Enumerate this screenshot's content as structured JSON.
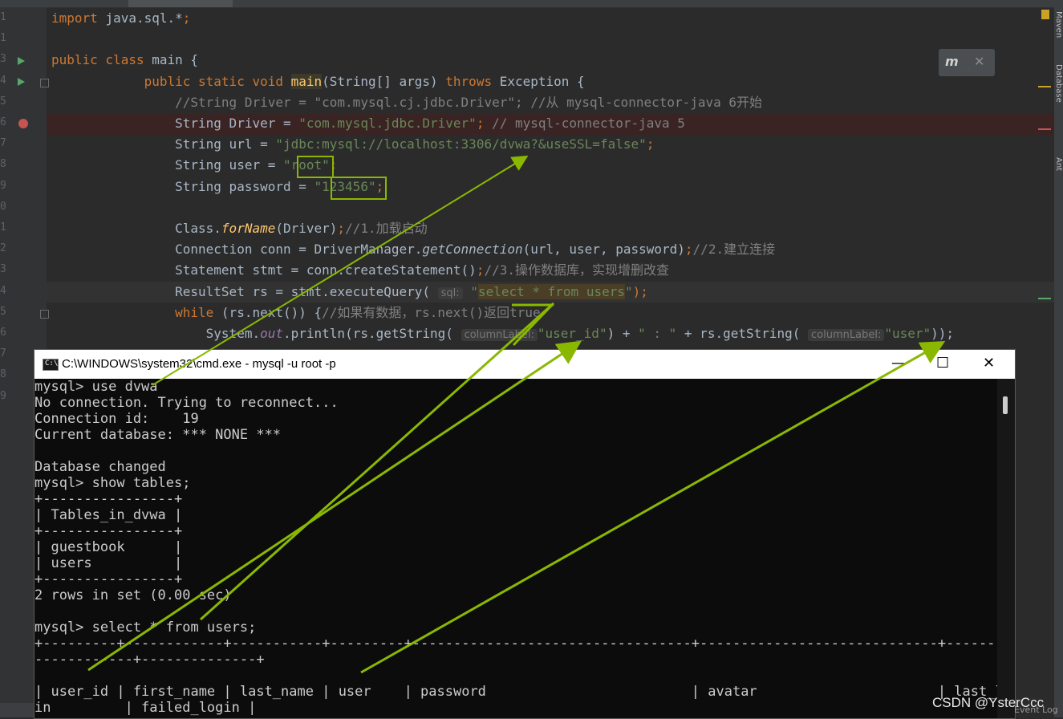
{
  "tabs": [
    "",
    "",
    "",
    ""
  ],
  "gutter": {
    "line_numbers": [
      "1",
      "1",
      "3",
      "4",
      "5",
      "6",
      "7",
      "8",
      "9",
      "0",
      "1",
      "2",
      "3",
      "4",
      "5",
      "6",
      "7",
      "8",
      "9"
    ],
    "partial_lines_below": [
      "8",
      "9"
    ]
  },
  "editor": {
    "lines": [
      {
        "segments": [
          {
            "t": "import ",
            "c": "kw"
          },
          {
            "t": "java.sql.*",
            "c": ""
          },
          {
            "t": ";",
            "c": "kw"
          }
        ]
      },
      {
        "segments": []
      },
      {
        "segments": [
          {
            "t": "public class ",
            "c": "kw"
          },
          {
            "t": "main {",
            "c": ""
          }
        ]
      },
      {
        "segments": [
          {
            "t": "            public static void ",
            "c": "kw"
          },
          {
            "t": "main",
            "c": "fn hl-main"
          },
          {
            "t": "(String[] args) ",
            "c": ""
          },
          {
            "t": "throws ",
            "c": "kw"
          },
          {
            "t": "Exception {",
            "c": ""
          }
        ]
      },
      {
        "segments": [
          {
            "t": "                //String Driver = \"com.mysql.cj.jdbc.Driver\"; //从 mysql-connector-java 6开始",
            "c": "cm"
          }
        ]
      },
      {
        "segments": [
          {
            "t": "                String Driver = ",
            "c": ""
          },
          {
            "t": "\"com.mysql.jdbc.Driver\"",
            "c": "str"
          },
          {
            "t": "; ",
            "c": "kw"
          },
          {
            "t": "// mysql-connector-java 5",
            "c": "cm"
          }
        ]
      },
      {
        "segments": [
          {
            "t": "                String url = ",
            "c": ""
          },
          {
            "t": "\"jdbc:mysql://localhost:3306/dvwa?&useSSL=false\"",
            "c": "str"
          },
          {
            "t": ";",
            "c": "kw"
          }
        ]
      },
      {
        "segments": [
          {
            "t": "                String user = ",
            "c": ""
          },
          {
            "t": "\"root\"",
            "c": "str"
          },
          {
            "t": ";",
            "c": "kw"
          }
        ]
      },
      {
        "segments": [
          {
            "t": "                String password = ",
            "c": ""
          },
          {
            "t": "\"123456\"",
            "c": "str"
          },
          {
            "t": ";",
            "c": "kw"
          }
        ]
      },
      {
        "segments": []
      },
      {
        "segments": [
          {
            "t": "                Class.",
            "c": ""
          },
          {
            "t": "forName",
            "c": "it fn"
          },
          {
            "t": "(Driver)",
            "c": ""
          },
          {
            "t": ";",
            "c": "kw"
          },
          {
            "t": "//1.加载启动",
            "c": "cm"
          }
        ]
      },
      {
        "segments": [
          {
            "t": "                Connection conn = DriverManager.",
            "c": ""
          },
          {
            "t": "getConnection",
            "c": "it"
          },
          {
            "t": "(url, user, password)",
            "c": ""
          },
          {
            "t": ";",
            "c": "kw"
          },
          {
            "t": "//2.建立连接",
            "c": "cm"
          }
        ]
      },
      {
        "segments": [
          {
            "t": "                Statement stmt = conn.createStatement()",
            "c": ""
          },
          {
            "t": ";",
            "c": "kw"
          },
          {
            "t": "//3.操作数据库，实现增删改查",
            "c": "cm"
          }
        ]
      },
      {
        "segments": [
          {
            "t": "                ResultSet rs = stmt.executeQuery( ",
            "c": ""
          },
          {
            "t": "sql:",
            "c": "hint"
          },
          {
            "t": " ",
            "c": ""
          },
          {
            "t": "\"",
            "c": "str"
          },
          {
            "t": "select * from users",
            "c": "str hl-sql"
          },
          {
            "t": "\"",
            "c": "str"
          },
          {
            "t": ");",
            "c": "kw"
          }
        ]
      },
      {
        "segments": [
          {
            "t": "                while ",
            "c": "kw"
          },
          {
            "t": "(rs.next()) {",
            "c": ""
          },
          {
            "t": "//如果有数据，rs.next()返回true",
            "c": "cm"
          }
        ]
      },
      {
        "segments": [
          {
            "t": "                    System.",
            "c": ""
          },
          {
            "t": "out",
            "c": "field"
          },
          {
            "t": ".println(rs.getString( ",
            "c": ""
          },
          {
            "t": "columnLabel:",
            "c": "hint"
          },
          {
            "t": "\"user_id\"",
            "c": "str"
          },
          {
            "t": ") + ",
            "c": ""
          },
          {
            "t": "\" : \"",
            "c": "str"
          },
          {
            "t": " + rs.getString( ",
            "c": ""
          },
          {
            "t": "columnLabel:",
            "c": "hint"
          },
          {
            "t": "\"user\"",
            "c": "str"
          },
          {
            "t": "));",
            "c": ""
          }
        ]
      }
    ]
  },
  "plugin_popup": {
    "logo": "m",
    "close": "✕"
  },
  "right_sidebar": {
    "tabs": [
      "Maven",
      "Database",
      "Ant"
    ]
  },
  "cmd_window": {
    "title": "C:\\WINDOWS\\system32\\cmd.exe - mysql  -u root -p",
    "icon_text": "C:\\",
    "minimize": "—",
    "maximize": "☐",
    "close": "✕",
    "lines": [
      "mysql> use dvwa",
      "No connection. Trying to reconnect...",
      "Connection id:    19",
      "Current database: *** NONE ***",
      "",
      "Database changed",
      "mysql> show tables;",
      "+----------------+",
      "| Tables_in_dvwa |",
      "+----------------+",
      "| guestbook      |",
      "| users          |",
      "+----------------+",
      "2 rows in set (0.00 sec)",
      "",
      "mysql> select * from users;",
      "+---------+------------+-----------+---------+----------------------------------+-----------------------------+--------",
      "------------+--------------+",
      "",
      "| user_id | first_name | last_name | user    | password                         | avatar                      | last_log",
      "in         | failed_login |",
      "+---------+------------+-----------+---------+----------------------------------+-----------------------------+--------"
    ]
  },
  "watermark": "CSDN @YsterCcc",
  "event_log": "Event Log",
  "colors": {
    "annotation": "#8ab800",
    "breakpoint": "#c75450",
    "run": "#59a869"
  }
}
